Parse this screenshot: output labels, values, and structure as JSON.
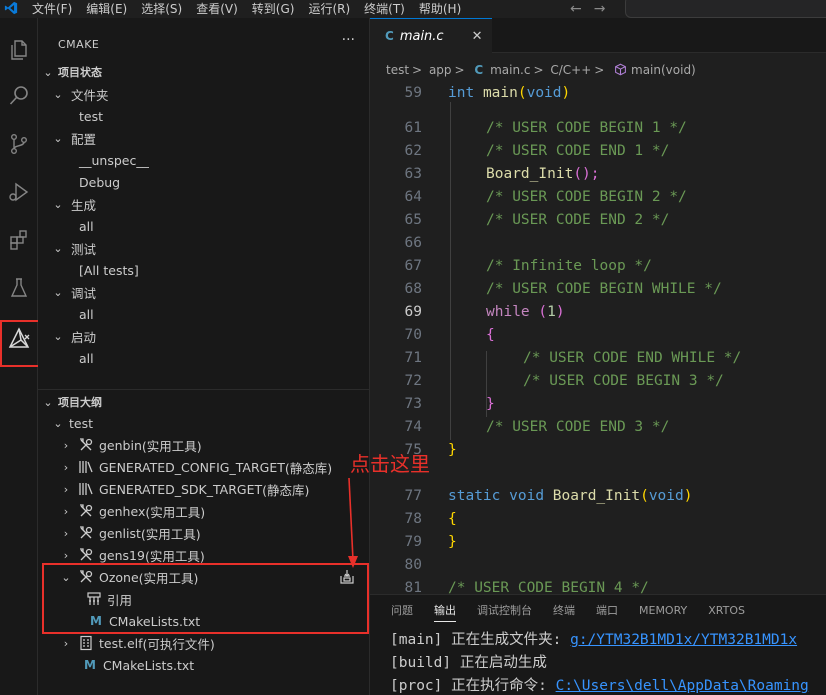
{
  "menu": [
    "文件(F)",
    "编辑(E)",
    "选择(S)",
    "查看(V)",
    "转到(G)",
    "运行(R)",
    "终端(T)",
    "帮助(H)"
  ],
  "nav": {
    "back": "←",
    "forward": "→"
  },
  "sidebar": {
    "title": "CMAKE",
    "more": "···",
    "status_header": "项目状态",
    "status_groups": [
      {
        "label": "文件夹",
        "child": "test"
      },
      {
        "label": "配置",
        "children": [
          "__unspec__",
          "Debug"
        ]
      },
      {
        "label": "生成",
        "child": "all"
      },
      {
        "label": "测试",
        "child": "[All tests]"
      },
      {
        "label": "调试",
        "child": "all"
      },
      {
        "label": "启动",
        "child": "all"
      }
    ],
    "outline_header": "项目大纲",
    "outline_root": "test",
    "outline_items": [
      {
        "label": "genbin",
        "suffix": " (实用工具)"
      },
      {
        "label": "GENERATED_CONFIG_TARGET",
        "suffix": " (静态库)"
      },
      {
        "label": "GENERATED_SDK_TARGET",
        "suffix": " (静态库)"
      },
      {
        "label": "genhex",
        "suffix": " (实用工具)"
      },
      {
        "label": "genlist",
        "suffix": " (实用工具)"
      },
      {
        "label": "gens19",
        "suffix": " (实用工具)"
      },
      {
        "label": "Ozone",
        "suffix": " (实用工具)"
      },
      {
        "label": "引用"
      },
      {
        "label": "CMakeLists.txt"
      },
      {
        "label": "test.elf",
        "suffix": " (可执行文件)"
      },
      {
        "label": "CMakeLists.txt"
      }
    ]
  },
  "annotation": "点击这里",
  "editor": {
    "tab": {
      "icon": "C",
      "name": "main.c",
      "close": "✕"
    },
    "breadcrumb": [
      "test",
      "app",
      "main.c",
      "C/C++",
      "main(void)"
    ],
    "breadcrumb_sep": ">",
    "breadcrumb_file_icon": "C",
    "lines": [
      {
        "n": "59"
      },
      {
        "n": "61"
      },
      {
        "n": "62"
      },
      {
        "n": "63"
      },
      {
        "n": "64"
      },
      {
        "n": "65"
      },
      {
        "n": "66"
      },
      {
        "n": "67"
      },
      {
        "n": "68"
      },
      {
        "n": "69"
      },
      {
        "n": "70"
      },
      {
        "n": "71"
      },
      {
        "n": "72"
      },
      {
        "n": "73"
      },
      {
        "n": "74"
      },
      {
        "n": "75"
      },
      {
        "n": "77"
      },
      {
        "n": "78"
      },
      {
        "n": "79"
      },
      {
        "n": "80"
      },
      {
        "n": "81"
      }
    ],
    "code": {
      "l59": [
        "int",
        " ",
        "main",
        "(",
        "void",
        ")"
      ],
      "l61": "/* USER CODE BEGIN 1 */",
      "l62": "/* USER CODE END 1 */",
      "l63": [
        "Board_Init",
        "();"
      ],
      "l64": "/* USER CODE BEGIN 2 */",
      "l65": "/* USER CODE END 2 */",
      "l67": "/* Infinite loop */",
      "l68": "/* USER CODE BEGIN WHILE */",
      "l69": [
        "while",
        " (",
        "1",
        ")"
      ],
      "l70": "{",
      "l71": "/* USER CODE END WHILE */",
      "l72": "/* USER CODE BEGIN 3 */",
      "l73": "}",
      "l74": "/* USER CODE END 3 */",
      "l75": "}",
      "l77": [
        "static",
        " ",
        "void",
        " ",
        "Board_Init",
        "(",
        "void",
        ")"
      ],
      "l78": "{",
      "l79": "}",
      "l81": "/* USER CODE BEGIN 4 */"
    }
  },
  "panel": {
    "tabs": [
      "问题",
      "输出",
      "调试控制台",
      "终端",
      "端口",
      "MEMORY",
      "XRTOS"
    ],
    "active": "输出",
    "out": [
      {
        "tag": "[main]",
        "text": " 正在生成文件夹: ",
        "link": "g:/YTM32B1MD1x/YTM32B1MD1x"
      },
      {
        "tag": "[build]",
        "text": " 正在启动生成"
      },
      {
        "tag": "[proc]",
        "text": " 正在执行命令: ",
        "path": "C:\\Users\\dell\\AppData\\Roaming"
      }
    ]
  },
  "colors": {
    "highlight": "#e8302a",
    "accent": "#0078d4"
  }
}
